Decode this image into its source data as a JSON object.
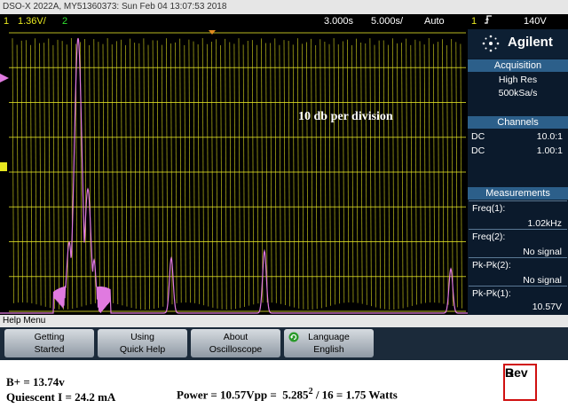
{
  "header": {
    "title": "DSO-X 2022A, MY51360373: Sun Feb 04 13:07:53 2018"
  },
  "status": {
    "ch1_num": "1",
    "ch1_scale": "1.36V/",
    "ch2_num": "2",
    "delay": "3.000s",
    "timebase": "5.000s/",
    "trigger_mode": "Auto",
    "trigger_ch": "1",
    "trigger_level": "140V",
    "trigger_icon": "rising-edge-icon"
  },
  "brand": {
    "name": "Agilent",
    "icon": "agilent-spark-icon"
  },
  "acquisition": {
    "header": "Acquisition",
    "mode": "High Res",
    "rate": "500kSa/s"
  },
  "channels": {
    "header": "Channels",
    "rows": [
      {
        "coupling": "DC",
        "ratio": "10.0:1",
        "color": "#e8e820"
      },
      {
        "coupling": "DC",
        "ratio": "1.00:1",
        "color": "#30e030"
      }
    ]
  },
  "measurements": {
    "header": "Measurements",
    "items": [
      {
        "label": "Freq(1):",
        "value": "1.02kHz"
      },
      {
        "label": "Freq(2):",
        "value": "No signal"
      },
      {
        "label": "Pk-Pk(2):",
        "value": "No signal"
      },
      {
        "label": "Pk-Pk(1):",
        "value": "10.57V"
      }
    ]
  },
  "overlay": {
    "note": "10 db  per division"
  },
  "help_menu": {
    "label": "Help Menu"
  },
  "softkeys": [
    {
      "line1": "Getting",
      "line2": "Started"
    },
    {
      "line1": "Using",
      "line2": "Quick Help"
    },
    {
      "line1": "About",
      "line2": "Oscilloscope"
    },
    {
      "line1": "Language",
      "line2": "English",
      "icon": "rotate-knob-icon"
    }
  ],
  "annotations": {
    "bplus": "B+ = 13.74v",
    "quiescent": "Quiescent I = 24.2 mA",
    "power": "Power = 10.57Vpp =  5.285",
    "power_exp": "2",
    "power_tail": " / 16 = 1.75 Watts",
    "rev_line1": "Rev",
    "rev_line2": "B"
  },
  "colors": {
    "ch1": "#e8e820",
    "ch2": "#30e030",
    "math": "#e07ae0",
    "grid": "#b8b820",
    "accent": "#2c5f8a",
    "rev_border": "#d01010"
  }
}
